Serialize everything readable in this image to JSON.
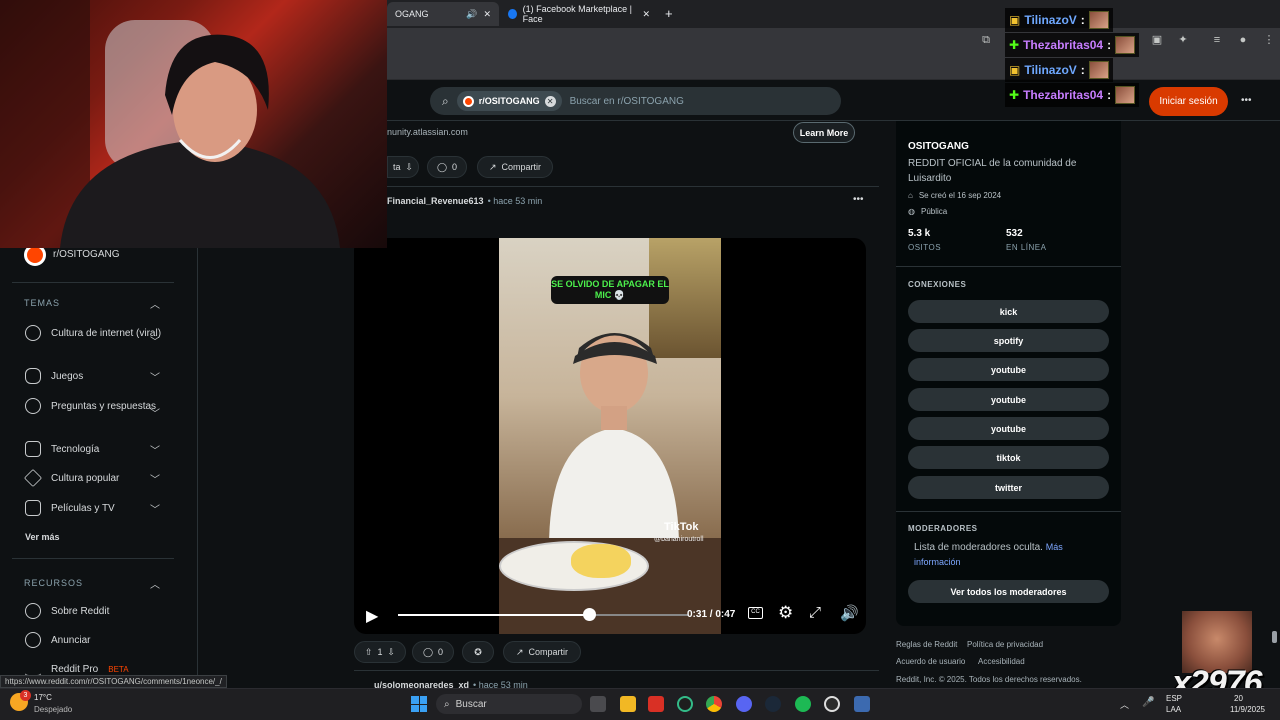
{
  "browser": {
    "tabs": [
      {
        "label": "OGANG",
        "active": true
      },
      {
        "label": "(1) Facebook Marketplace | Face",
        "active": false
      }
    ],
    "new_tab": "+",
    "status_url": "https://www.reddit.com/r/OSITOGANG/comments/1neonce/_/"
  },
  "header": {
    "search_chip": "r/OSITOGANG",
    "search_placeholder": "Buscar en r/OSITOGANG",
    "login_label": "Iniciar sesión",
    "more": "•••"
  },
  "sidebar": {
    "current_sub": "r/OSITOGANG",
    "temas_label": "TEMAS",
    "temas": [
      {
        "label": "Cultura de internet (viral)"
      },
      {
        "label": "Juegos"
      },
      {
        "label": "Preguntas y respuestas"
      },
      {
        "label": "Tecnología"
      },
      {
        "label": "Cultura popular"
      },
      {
        "label": "Películas y TV"
      }
    ],
    "ver_mas": "Ver más",
    "recursos_label": "RECURSOS",
    "recursos": [
      {
        "label": "Sobre Reddit"
      },
      {
        "label": "Anunciar"
      },
      {
        "label": "Reddit Pro",
        "badge": "BETA"
      }
    ]
  },
  "feed": {
    "ad_url": "nunity.atlassian.com",
    "learn_more": "Learn More",
    "ad_vote_label": "ta",
    "ad_comments": "0",
    "share_label": "Compartir",
    "post1": {
      "author": "Financial_Revenue613",
      "time": "• hace 53 min",
      "video": {
        "caption": "SE OLVIDO DE APAGAR EL MIC 💀",
        "tiktok": "TikTok",
        "tiktok_user": "@bananiroutroll",
        "time": "0:31 / 0:47",
        "progress": 0.66
      },
      "votes": "1",
      "comments": "0"
    },
    "post2": {
      "author": "u/solomeonaredes_xd",
      "time": "• hace 53 min"
    }
  },
  "community": {
    "name": "OSITOGANG",
    "description": "REDDIT OFICIAL de la comunidad de Luisardito",
    "created": "Se creó el 16 sep 2024",
    "visibility": "Pública",
    "members_value": "5.3 k",
    "members_label": "OSITOS",
    "online_value": "532",
    "online_label": "EN LÍNEA",
    "connections_label": "CONEXIONES",
    "connections": [
      "kick",
      "spotify",
      "youtube",
      "youtube",
      "youtube",
      "tiktok",
      "twitter"
    ],
    "mods_label": "MODERADORES",
    "mods_text": "Lista de moderadores oculta.",
    "mods_link": "Más información",
    "view_mods": "Ver todos los moderadores"
  },
  "footer": {
    "links": [
      "Reglas de Reddit",
      "Política de privacidad",
      "Acuerdo de usuario",
      "Accesibilidad"
    ],
    "copyright": "Reddit, Inc. © 2025. Todos los derechos reservados."
  },
  "stream": {
    "chat": [
      {
        "user": "TilinazoV",
        "color": "#6fa8ff"
      },
      {
        "user": "Thezabritas04",
        "color": "#c77dff"
      },
      {
        "user": "TilinazoV",
        "color": "#6fa8ff"
      },
      {
        "user": "Thezabritas04",
        "color": "#c77dff"
      }
    ],
    "chat_sep": ":",
    "watermark": "x2976"
  },
  "taskbar": {
    "weather_temp": "17°C",
    "weather_desc": "Despejado",
    "weather_badge": "3",
    "search": "Buscar",
    "lang1": "ESP",
    "lang2": "LAA",
    "time": "20",
    "date": "11/9/2025"
  }
}
